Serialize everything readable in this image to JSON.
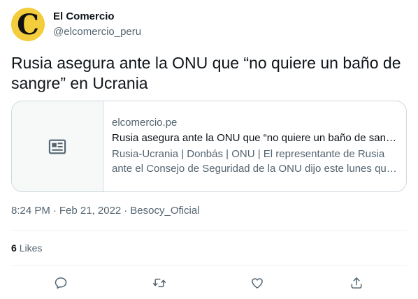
{
  "author": {
    "display_name": "El Comercio",
    "handle": "@elcomercio_peru",
    "avatar_letter": "C",
    "avatar_color": "#f3cd3c"
  },
  "tweet": {
    "text": "Rusia asegura ante la ONU que “no quiere un baño de sangre” en Ucrania"
  },
  "card": {
    "domain": "elcomercio.pe",
    "title": "Rusia asegura ante la ONU que “no quiere un baño de sangre” en Ucrania",
    "description": "Rusia-Ucrania | Donbás | ONU | El representante de Rusia ante el Consejo de Seguridad de la ONU dijo este lunes que no quiere un baño de sangre",
    "media_icon": "newspaper-icon"
  },
  "meta": {
    "time": "8:24 PM",
    "date": "Feb 21, 2022",
    "source": "Besocy_Oficial",
    "separator": "·"
  },
  "stats": {
    "likes_count": "6",
    "likes_label": "Likes"
  },
  "actions": {
    "reply_icon": "reply-icon",
    "retweet_icon": "retweet-icon",
    "like_icon": "heart-icon",
    "share_icon": "share-icon"
  },
  "colors": {
    "text_primary": "#0f1419",
    "text_secondary": "#536471",
    "border": "#cfd9de"
  }
}
